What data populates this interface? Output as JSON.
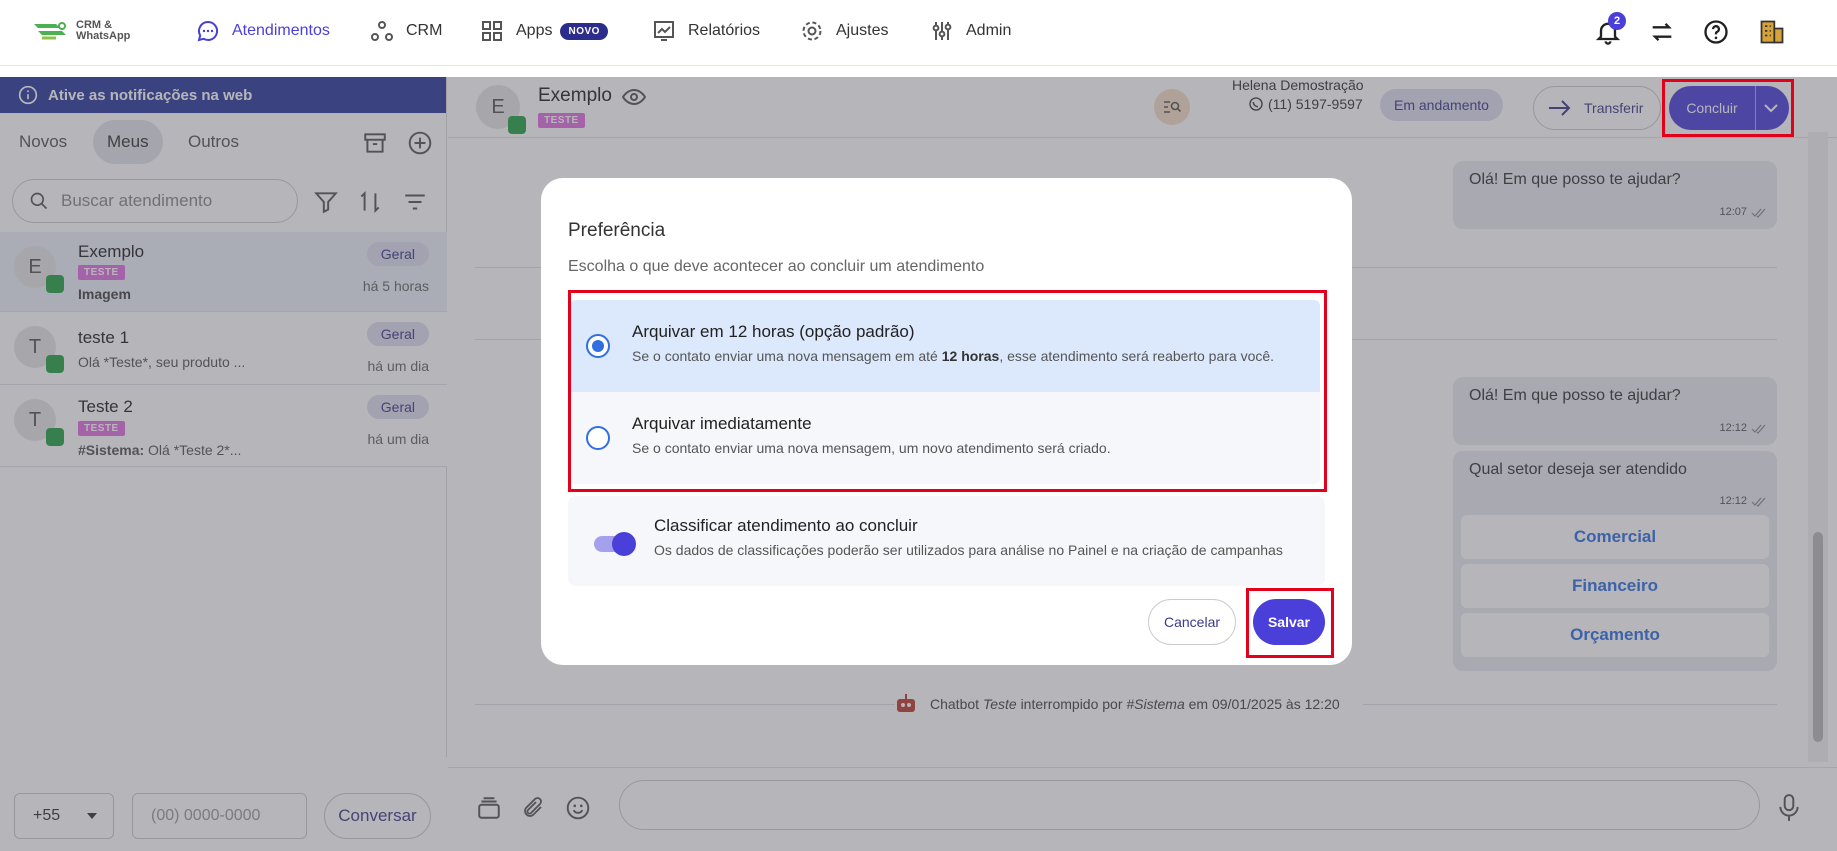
{
  "app": {
    "logo_line1": "CRM &",
    "logo_line2": "WhatsApp"
  },
  "nav": {
    "atendimentos": "Atendimentos",
    "crm": "CRM",
    "apps": "Apps",
    "apps_badge": "NOVO",
    "relatorios": "Relatórios",
    "ajustes": "Ajustes",
    "admin": "Admin",
    "notification_count": "2"
  },
  "left": {
    "notification_banner": "Ative as notificações na web",
    "tabs": [
      "Novos",
      "Meus",
      "Outros"
    ],
    "selected_tab": "Meus",
    "search_placeholder": "Buscar atendimento",
    "conversations": [
      {
        "initial": "E",
        "name": "Exemplo",
        "tag": "TESTE",
        "message": "Imagem",
        "queue": "Geral",
        "time": "há 5 horas"
      },
      {
        "initial": "T",
        "name": "teste 1",
        "tag": "",
        "message": "Olá *Teste*, seu produto ...",
        "queue": "Geral",
        "time": "há um dia"
      },
      {
        "initial": "T",
        "name": "Teste 2",
        "tag": "TESTE",
        "message_prefix": "#Sistema:",
        "message": " Olá *Teste 2*...",
        "queue": "Geral",
        "time": "há um dia"
      }
    ],
    "country_code": "+55",
    "phone_placeholder": "(00) 0000-0000",
    "conversar_button": "Conversar"
  },
  "chat_header": {
    "initial": "E",
    "contact_name": "Exemplo",
    "tag": "TESTE",
    "agent_name": "Helena Demostração",
    "agent_phone": "(11) 5197-9597",
    "status": "Em andamento",
    "transfer_button": "Transferir",
    "conclude_button": "Concluir"
  },
  "chat": {
    "messages": [
      {
        "text": "Olá! Em que posso te ajudar?",
        "time": "12:07"
      },
      {
        "text": "Olá! Em que posso te ajudar?",
        "time": "12:12"
      },
      {
        "text": "Qual setor deseja ser atendido",
        "time": "12:12"
      }
    ],
    "options": [
      "Comercial",
      "Financeiro",
      "Orçamento"
    ],
    "system_prefix": "Chatbot",
    "system_bot": "Teste",
    "system_mid": "interrompido por",
    "system_actor": "#Sistema",
    "system_suffix": "em 09/01/2025 às 12:20"
  },
  "modal": {
    "title": "Preferência",
    "subtitle": "Escolha o que deve acontecer ao concluir um atendimento",
    "option1_title": "Arquivar em 12 horas (opção padrão)",
    "option1_desc_a": "Se o contato enviar uma nova mensagem em até",
    "option1_desc_bold": "12 horas",
    "option1_desc_b": ", esse atendimento será reaberto para você.",
    "option2_title": "Arquivar imediatamente",
    "option2_desc": "Se o contato enviar uma nova mensagem, um novo atendimento será criado.",
    "toggle_title": "Classificar atendimento ao concluir",
    "toggle_desc": "Os dados de classificações poderão ser utilizados para análise no Painel e na criação de campanhas",
    "toggle_on": true,
    "cancel_button": "Cancelar",
    "save_button": "Salvar"
  },
  "colors": {
    "accent": "#4a3fd8",
    "highlight_box": "#e3001b",
    "banner": "#2a3a9a"
  }
}
